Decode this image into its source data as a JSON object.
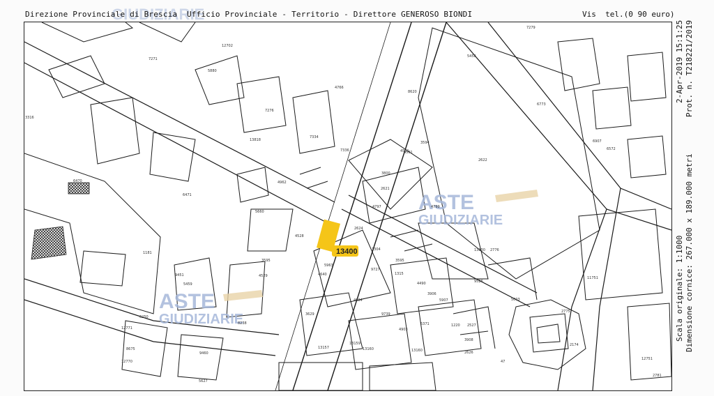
{
  "header": {
    "left": "Direzione Provinciale di Brescia  Ufficio Provinciale - Territorio - Direttore GENEROSO BIONDI",
    "right": "Vis  tel.(0 90 euro)"
  },
  "side_right": {
    "date": "2-Apr-2019 15:1:25",
    "prot": "Prot. n. T218221/2019",
    "scale": "Scala originale: 1:1000",
    "dimension": "Dimensione cornice: 267.000 x 189.000 metri"
  },
  "highlight": {
    "label": "13400",
    "color": "#f5c518"
  },
  "watermarks": [
    {
      "line1": "ASTE",
      "line2": "GIUDIZIARIE"
    },
    {
      "line1": "ASTE",
      "line2": "GIUDIZIARIE"
    },
    {
      "line1": "GIUDIZIARIE"
    }
  ],
  "parcels": [
    "7271",
    "12702",
    "5880",
    "7276",
    "4766",
    "8620",
    "7279",
    "5458",
    "3316",
    "13818",
    "7334",
    "7336",
    "6773",
    "6907",
    "6572",
    "6470",
    "6471",
    "4962",
    "5660",
    "4528",
    "3595",
    "4529",
    "1181",
    "9451",
    "5459",
    "8238",
    "6250",
    "12771",
    "8675",
    "9460",
    "12770",
    "5627",
    "13160",
    "3594",
    "4501",
    "2622",
    "3800",
    "2621",
    "4797",
    "4799",
    "2624",
    "1304",
    "3595",
    "9727",
    "4490",
    "1315",
    "3906",
    "5907",
    "4684",
    "9739",
    "4903",
    "5371",
    "1220",
    "2527",
    "3908",
    "2626",
    "13157",
    "13159",
    "13160",
    "3629",
    "4640",
    "5963",
    "4501",
    "2776",
    "9526",
    "11751",
    "5003",
    "2775",
    "2174",
    "12751",
    "2781",
    "47",
    "13830"
  ],
  "colors": {
    "lines": "#1a1a1a",
    "watermark": "#9fb3d6",
    "hammer": "#e8d3a8"
  }
}
